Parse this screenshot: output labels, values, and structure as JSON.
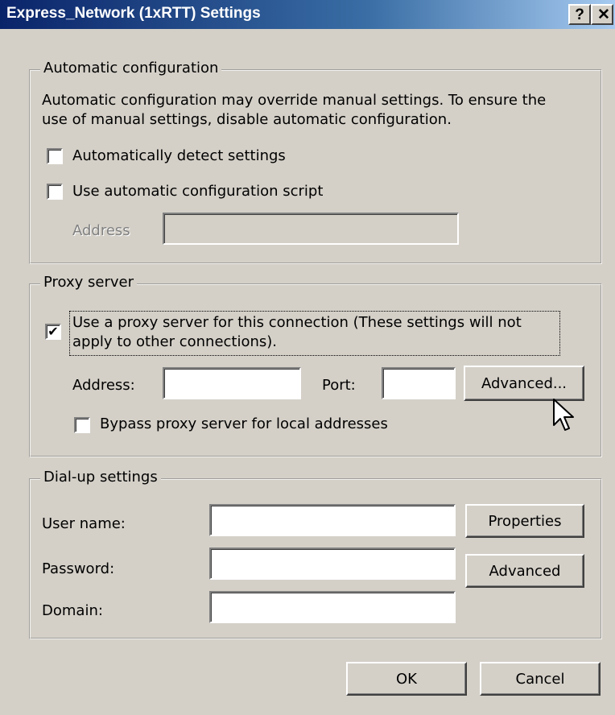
{
  "window": {
    "title": "Express_Network (1xRTT) Settings"
  },
  "titlebar": {
    "help_label": "?",
    "close_label": "✕"
  },
  "auto_config": {
    "group_title": "Automatic configuration",
    "description_line1": "Automatic configuration may override manual settings.  To ensure the",
    "description_line2": "use of manual settings, disable automatic configuration.",
    "detect_settings_label": "Automatically detect settings",
    "detect_settings_checked": false,
    "use_script_label": "Use automatic configuration script",
    "use_script_checked": false,
    "address_label": "Address",
    "address_value": ""
  },
  "proxy": {
    "group_title": "Proxy server",
    "use_proxy_line1": "Use a proxy server for this connection (These settings will not",
    "use_proxy_line2": "apply to other connections).",
    "use_proxy_checked": true,
    "check_mark": "✔",
    "address_label": "Address:",
    "address_value": "",
    "port_label": "Port:",
    "port_value": "",
    "advanced_label": "Advanced...",
    "bypass_label": "Bypass proxy server for local addresses",
    "bypass_checked": false
  },
  "dialup": {
    "group_title": "Dial-up settings",
    "username_label": "User name:",
    "username_value": "",
    "password_label": "Password:",
    "password_value": "",
    "domain_label": "Domain:",
    "domain_value": "",
    "properties_label": "Properties",
    "advanced_label": "Advanced"
  },
  "footer": {
    "ok_label": "OK",
    "cancel_label": "Cancel"
  }
}
